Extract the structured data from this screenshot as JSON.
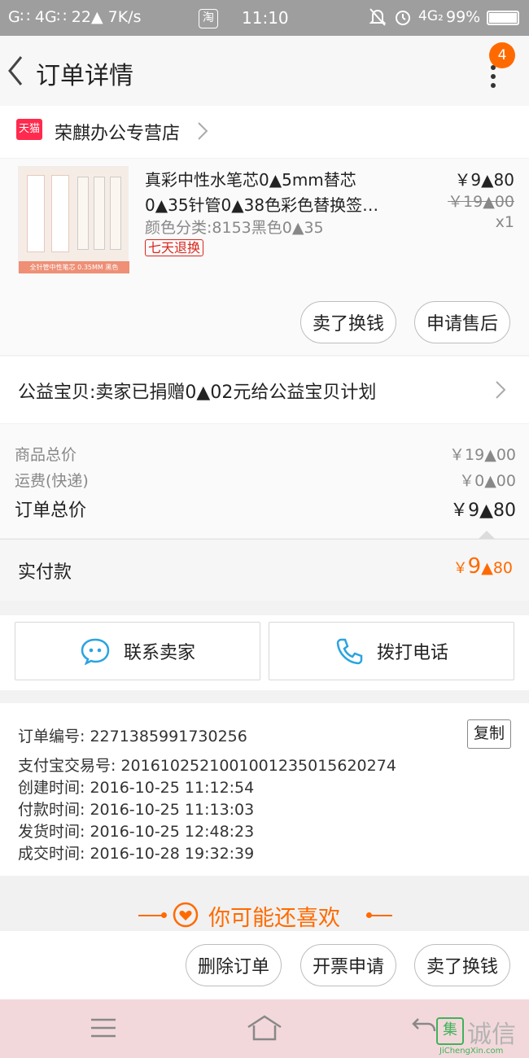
{
  "status_bar": {
    "left": "G∷ 4G∷ 22▲ 7K/s",
    "tb_icon": "淘",
    "time": "11:10",
    "network": "4G₂",
    "battery": "99%"
  },
  "header": {
    "title": "订单详情",
    "badge_count": "4"
  },
  "shop": {
    "tag": "天猫",
    "name": "荣麒办公专营店"
  },
  "product": {
    "title_line1": "真彩中性水笔芯0▲5mm替芯",
    "title_line2": "0▲35针管0▲38色彩色替换签…",
    "sku": "颜色分类:8153黑色0▲35",
    "return_tag": "七天退换",
    "price": "￥9▲80",
    "original_price": "￥19▲00",
    "qty": "x1",
    "image_caption": "全针管中性笔芯 0.35MM  黑色"
  },
  "item_actions": {
    "sell": "卖了换钱",
    "after_sale": "申请售后"
  },
  "charity": {
    "text": "公益宝贝:卖家已捐赠0▲02元给公益宝贝计划"
  },
  "summary": {
    "goods_label": "商品总价",
    "goods_value": "￥19▲00",
    "shipping_label": "运费(快递)",
    "shipping_value": "￥0▲00",
    "total_label": "订单总价",
    "total_value": "￥9▲80",
    "paid_label": "实付款",
    "paid_currency": "￥",
    "paid_int": "9",
    "paid_dec": "▲80"
  },
  "contact": {
    "seller": "联系卖家",
    "phone": "拨打电话"
  },
  "order_info": {
    "copy": "复制",
    "lines": [
      "订单编号: 2271385991730256",
      "支付宝交易号: 2016102521001001235015620274",
      "创建时间: 2016-10-25  11:12:54",
      "付款时间: 2016-10-25  11:13:03",
      "发货时间: 2016-10-25  12:48:23",
      "成交时间: 2016-10-28  19:32:39"
    ]
  },
  "recommend": {
    "title": "你可能还喜欢"
  },
  "bottom_actions": {
    "delete": "删除订单",
    "invoice": "开票申请",
    "sell": "卖了换钱"
  },
  "watermark": {
    "brand": "诚信",
    "url": "JiChengXin.com"
  },
  "colors": {
    "accent": "#ff6a00",
    "status_bar": "#9e9e9e",
    "sys_nav": "#f3d8db"
  }
}
